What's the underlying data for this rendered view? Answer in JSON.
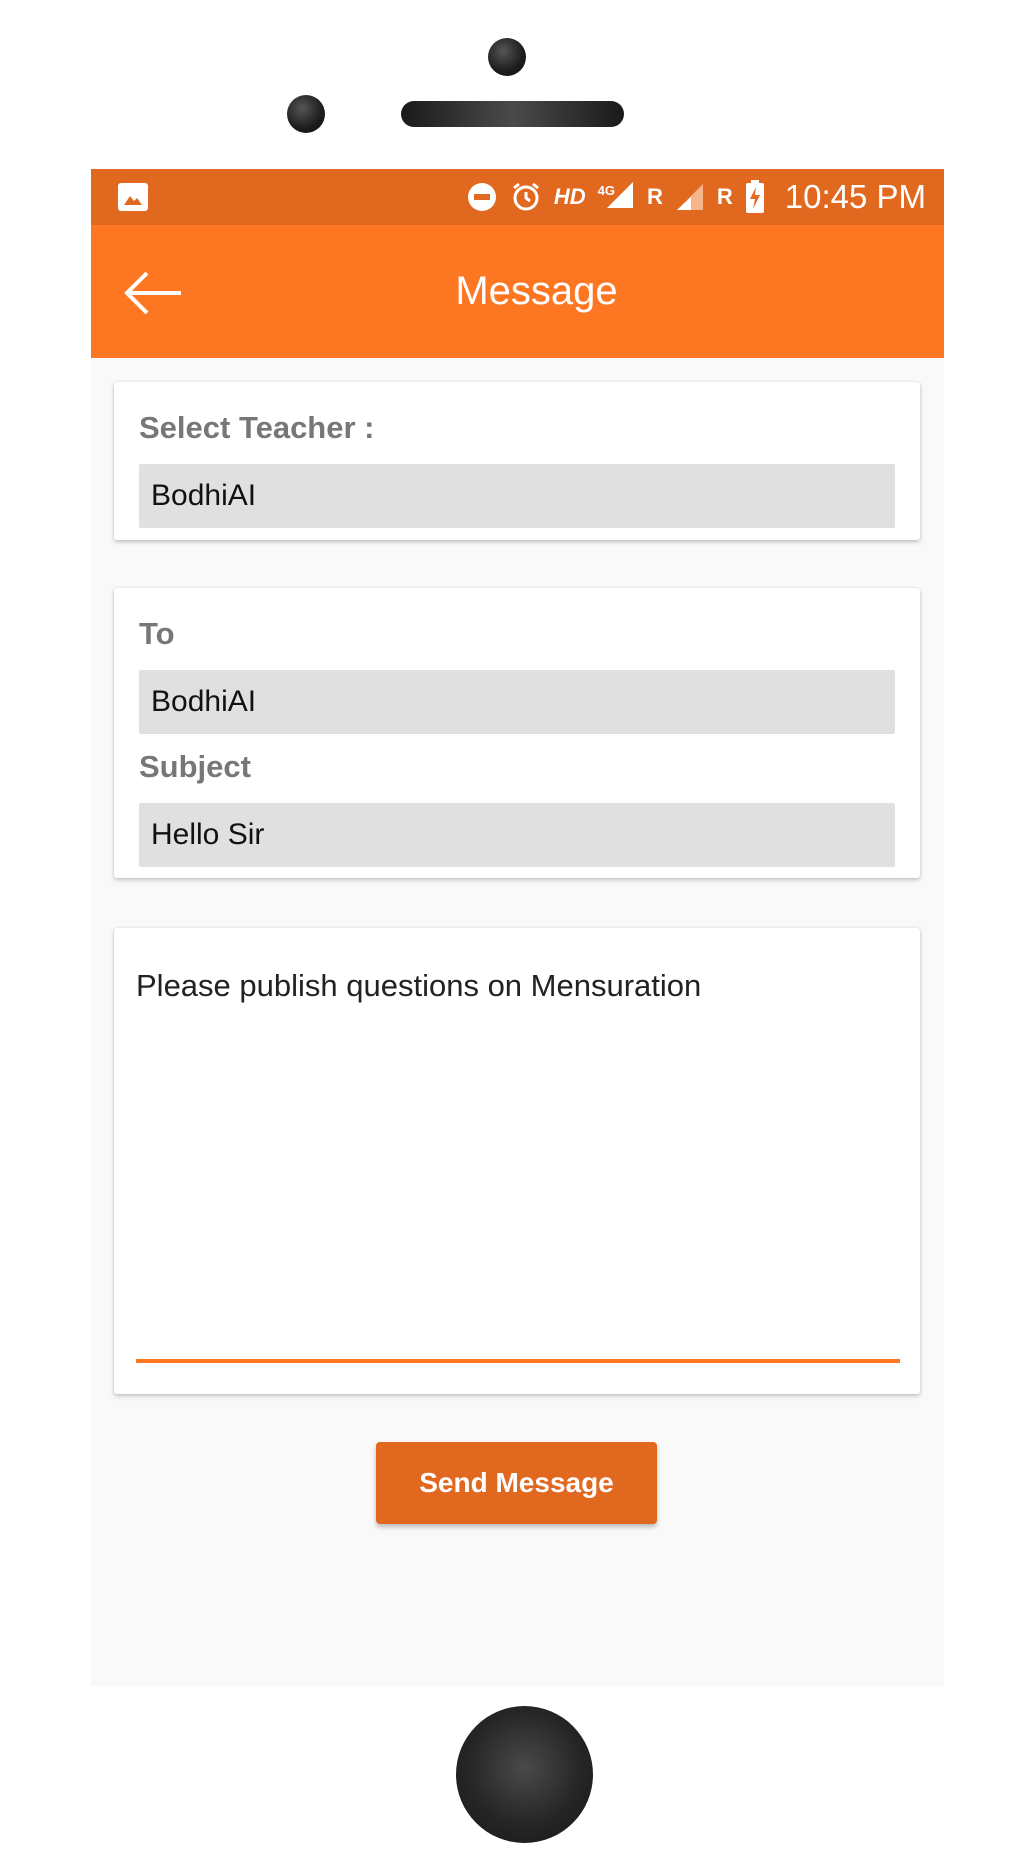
{
  "status_bar": {
    "hd_label": "HD",
    "network_label": "4G",
    "roaming_1": "R",
    "roaming_2": "R",
    "time": "10:45 PM",
    "icons": [
      "image-icon",
      "do-not-disturb-icon",
      "alarm-icon",
      "signal-icon",
      "signal-weak-icon",
      "battery-charging-icon"
    ]
  },
  "app_bar": {
    "title": "Message",
    "back_icon": "arrow-back-icon"
  },
  "teacher_card": {
    "label": "Select Teacher :",
    "value": "BodhiAI"
  },
  "address_card": {
    "to_label": "To",
    "to_value": "BodhiAI",
    "subject_label": "Subject",
    "subject_value": "Hello Sir"
  },
  "message_card": {
    "body": "Please publish questions on Mensuration"
  },
  "actions": {
    "send_label": "Send Message"
  },
  "colors": {
    "status_bar": "#e0681f",
    "app_bar": "#fd7622",
    "accent": "#fd7622",
    "button": "#e0681f",
    "field_bg": "#e0e0e0",
    "label_text": "#777777"
  }
}
